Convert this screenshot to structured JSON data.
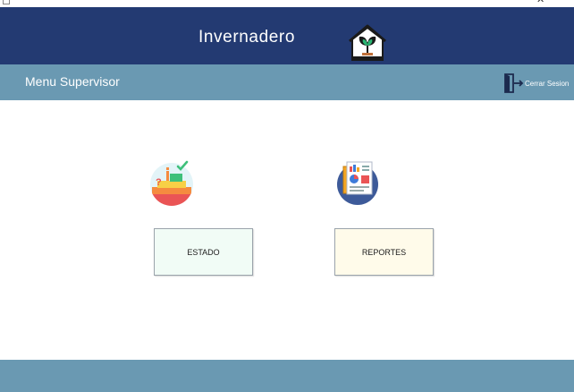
{
  "header": {
    "title": "Invernadero",
    "logo_icon": "greenhouse-plant-icon"
  },
  "subheader": {
    "title": "Menu Supervisor",
    "logout": {
      "label": "Cerrar Sesion",
      "icon": "logout-door-icon"
    }
  },
  "menu": {
    "estado": {
      "label": "ESTADO",
      "icon": "status-stack-icon"
    },
    "reportes": {
      "label": "REPORTES",
      "icon": "reports-documents-icon"
    }
  },
  "colors": {
    "header_bg": "#233a72",
    "subheader_bg": "#6a99b2",
    "footer_bg": "#6a99b2",
    "estado_button_bg": "#f1fcf6",
    "reportes_button_bg": "#fffbea"
  }
}
